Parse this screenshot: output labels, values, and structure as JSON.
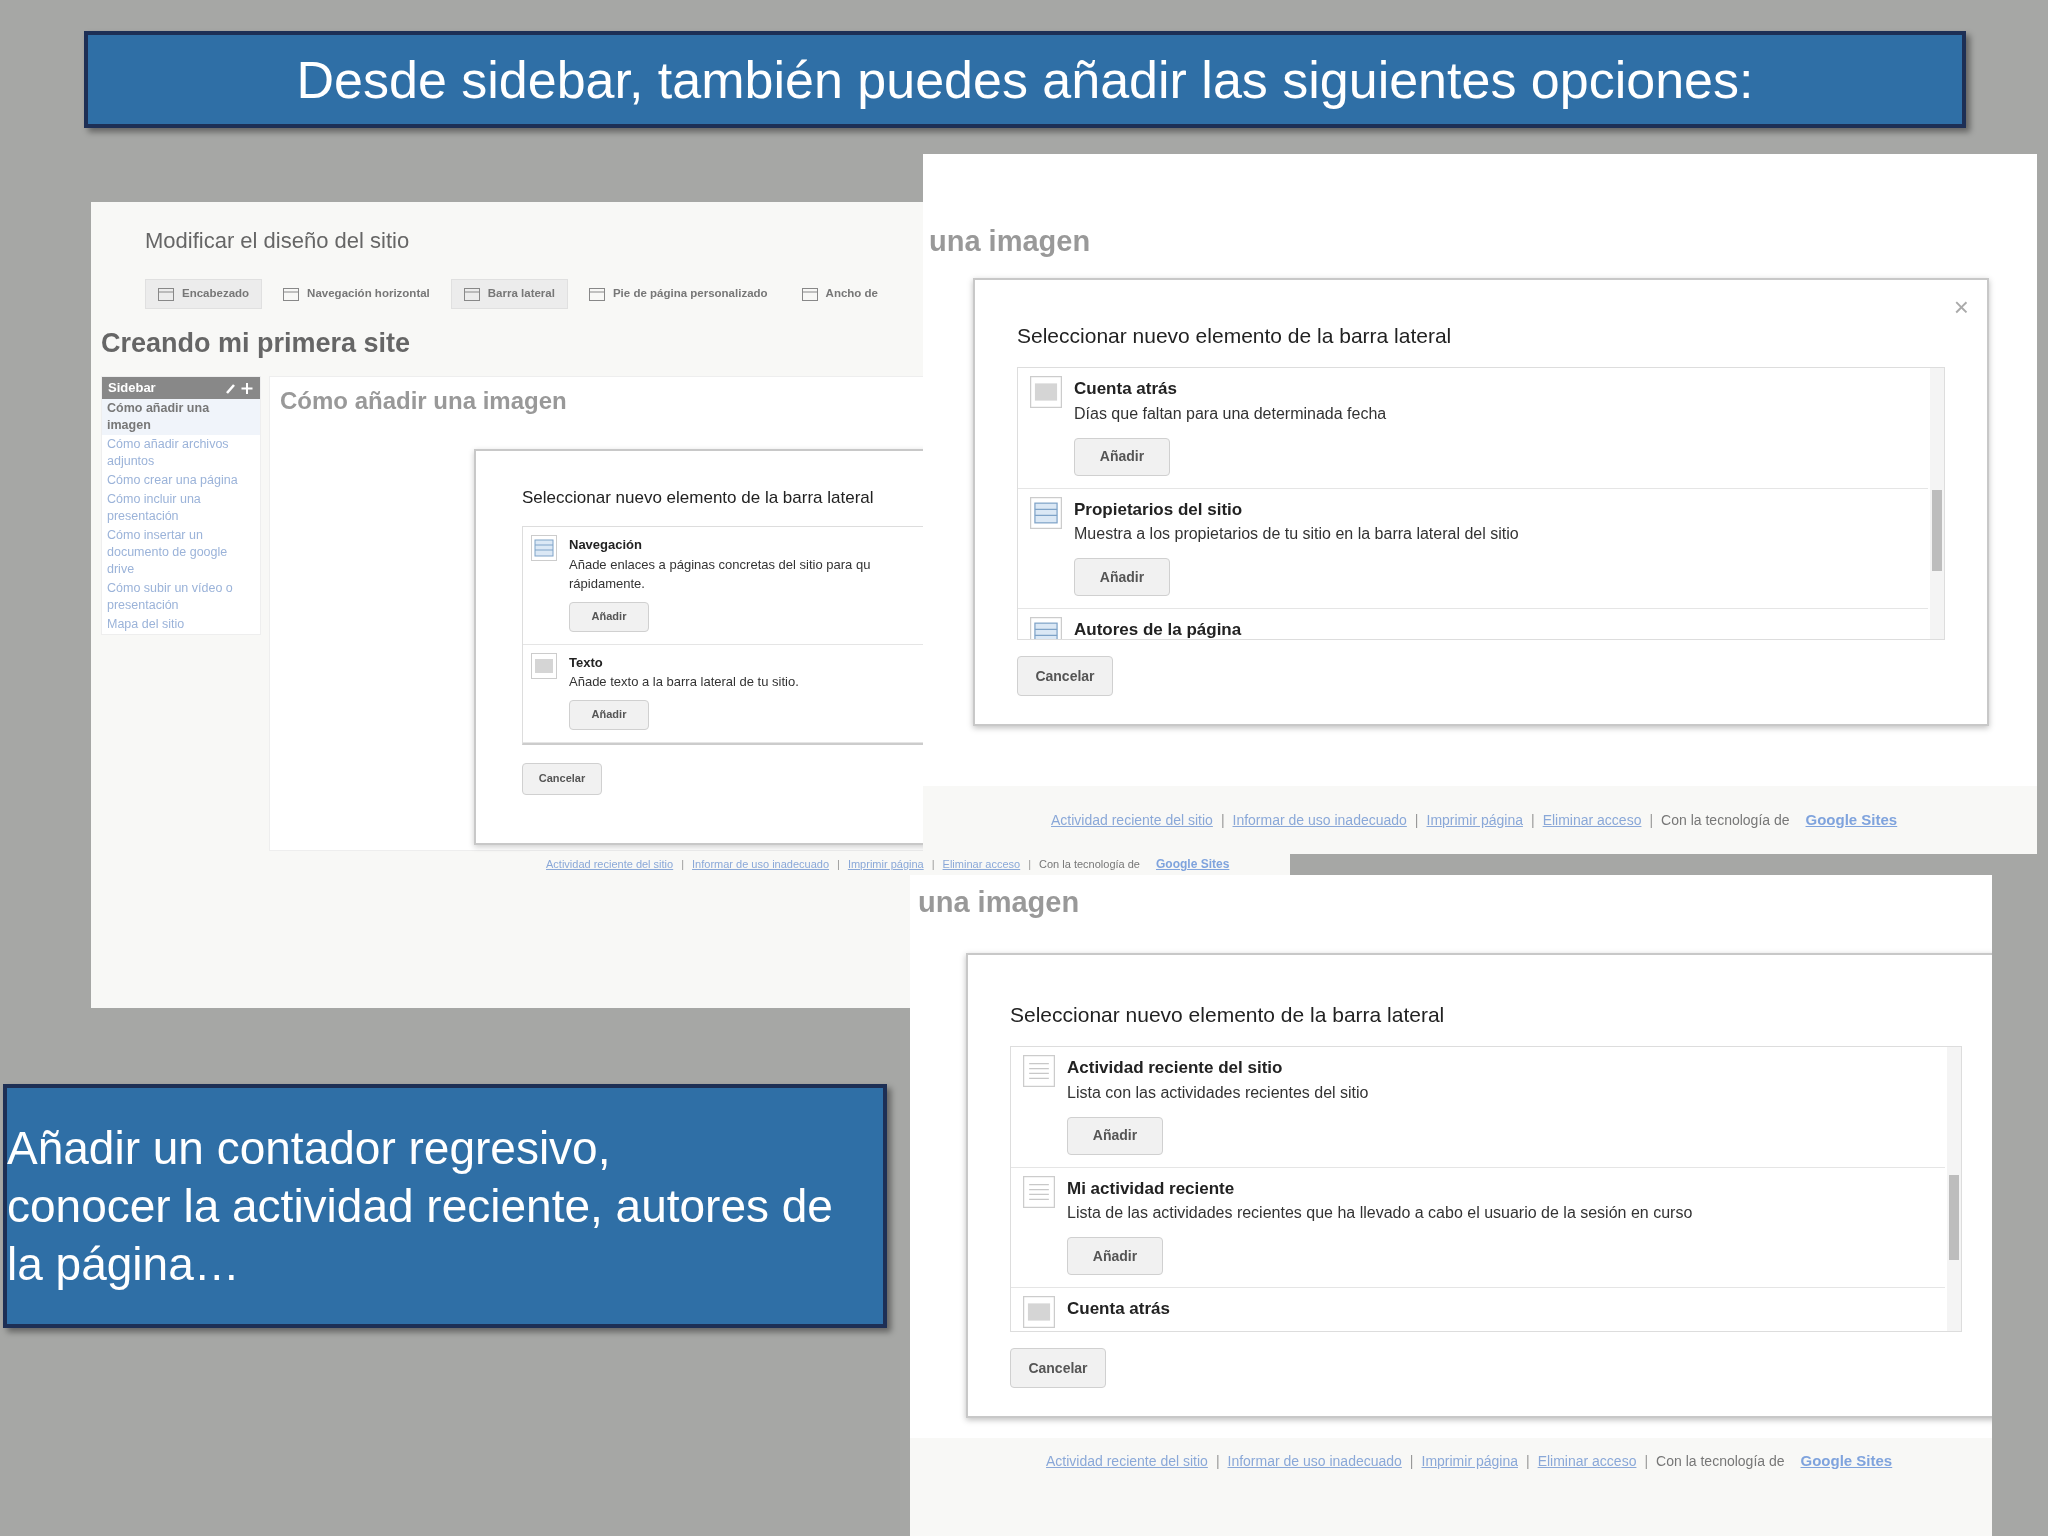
{
  "title": "Desde sidebar, también puedes añadir las siguientes opciones:",
  "left_screenshot": {
    "header": "Modificar el diseño del sitio",
    "tabs": [
      {
        "label": "Encabezado",
        "selected": true
      },
      {
        "label": "Navegación horizontal",
        "selected": false
      },
      {
        "label": "Barra lateral",
        "selected": true
      },
      {
        "label": "Pie de página personalizado",
        "selected": false
      },
      {
        "label": "Ancho de",
        "selected": false
      }
    ],
    "site_title": "Creando mi primera site",
    "sidebar": {
      "title": "Sidebar",
      "items": [
        {
          "label": "Cómo añadir una imagen",
          "selected": true
        },
        {
          "label": "Cómo añadir archivos adjuntos",
          "selected": false
        },
        {
          "label": "Cómo crear una página",
          "selected": false
        },
        {
          "label": "Cómo incluir una presentación",
          "selected": false
        },
        {
          "label": "Cómo insertar un documento de google drive",
          "selected": false
        },
        {
          "label": "Cómo subir un vídeo o presentación",
          "selected": false
        },
        {
          "label": "Mapa del sitio",
          "selected": false
        }
      ]
    },
    "page_title": "Cómo añadir una imagen",
    "dialog": {
      "title": "Seleccionar nuevo elemento de la barra lateral",
      "items": [
        {
          "kind": "list",
          "name": "Navegación",
          "description": [
            "Añade enlaces a páginas concretas del sitio para qu",
            "rápidamente."
          ],
          "button": "Añadir"
        },
        {
          "kind": "text",
          "name": "Texto",
          "description": [
            "Añade texto a la barra lateral de tu sitio."
          ],
          "button": "Añadir"
        }
      ],
      "cancel": "Cancelar"
    },
    "footer": {
      "links": [
        "Actividad reciente del sitio",
        "Informar de uso inadecuado",
        "Imprimir página",
        "Eliminar acceso"
      ],
      "separator": "|",
      "powered_by": "Con la tecnología de",
      "brand": "Google Sites"
    }
  },
  "top_screenshot": {
    "page_title": "una imagen",
    "close": "×",
    "dialog": {
      "title": "Seleccionar nuevo elemento de la barra lateral",
      "items": [
        {
          "kind": "text",
          "name": "Cuenta atrás",
          "description": [
            "Días que faltan para una determinada fecha"
          ],
          "button": "Añadir"
        },
        {
          "kind": "list",
          "name": "Propietarios del sitio",
          "description": [
            "Muestra a los propietarios de tu sitio en la barra lateral del sitio"
          ],
          "button": "Añadir"
        },
        {
          "kind": "list",
          "name": "Autores de la página"
        }
      ],
      "cancel": "Cancelar"
    },
    "footer": {
      "links": [
        "Actividad reciente del sitio",
        "Informar de uso inadecuado",
        "Imprimir página",
        "Eliminar acceso"
      ],
      "separator": "|",
      "powered_by": "Con la tecnología de",
      "brand": "Google Sites"
    }
  },
  "bottom_screenshot": {
    "page_title": "una imagen",
    "dialog": {
      "title": "Seleccionar nuevo elemento de la barra lateral",
      "items": [
        {
          "kind": "lines",
          "name": "Actividad reciente del sitio",
          "description": [
            "Lista con las actividades recientes del sitio"
          ],
          "button": "Añadir"
        },
        {
          "kind": "lines",
          "name": "Mi actividad reciente",
          "description": [
            "Lista de las actividades recientes que ha llevado a cabo el usuario de la sesión en curso"
          ],
          "button": "Añadir"
        },
        {
          "kind": "text",
          "name": "Cuenta atrás"
        }
      ],
      "cancel": "Cancelar"
    },
    "footer": {
      "links": [
        "Actividad reciente del sitio",
        "Informar de uso inadecuado",
        "Imprimir página",
        "Eliminar acceso"
      ],
      "separator": "|",
      "powered_by": "Con la tecnología de",
      "brand": "Google Sites"
    }
  },
  "note": [
    "Añadir un contador regresivo,",
    "conocer la actividad reciente, autores de",
    "la página…"
  ]
}
